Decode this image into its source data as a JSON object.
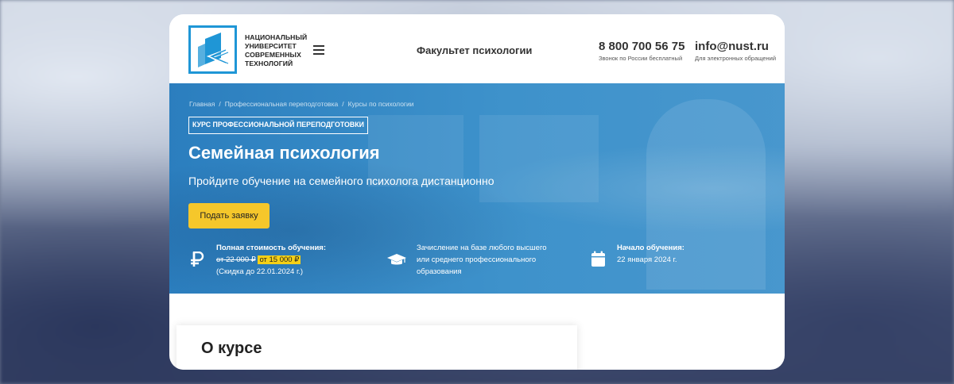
{
  "header": {
    "logo_lines": [
      "НАЦИОНАЛЬНЫЙ",
      "УНИВЕРСИТЕТ",
      "СОВРЕМЕННЫХ",
      "ТЕХНОЛОГИЙ"
    ],
    "faculty": "Факультет психологии",
    "phone": "8 800 700 56 75",
    "phone_note": "Звонок по России бесплатный",
    "email": "info@nust.ru",
    "email_note": "Для электронных обращений"
  },
  "breadcrumbs": [
    "Главная",
    "Профессиональная переподготовка",
    "Курсы по психологии"
  ],
  "hero": {
    "tag": "КУРС ПРОФЕССИОНАЛЬНОЙ ПЕРЕПОДГОТОВКИ",
    "title": "Семейная психология",
    "subtitle": "Пройдите обучение на семейного психолога дистанционно",
    "apply_button": "Подать заявку"
  },
  "features": {
    "price": {
      "label": "Полная стоимость обучения:",
      "old_price": "от 22 000 ₽",
      "new_price": "от 15 000 ₽",
      "discount_note": "(Скидка до 22.01.2024 г.)",
      "icon": "ruble-icon"
    },
    "enrollment": {
      "lines": [
        "Зачисление на базе любого высшего",
        "или среднего профессионального",
        "образования"
      ],
      "icon": "graduation-cap-icon"
    },
    "start": {
      "label": "Начало обучения:",
      "date": "22 января 2024 г.",
      "icon": "calendar-icon"
    }
  },
  "about": {
    "title": "О курсе"
  },
  "colors": {
    "brand_blue": "#1f96d6",
    "hero_blue": "#3e92cb",
    "accent_yellow": "#f5c72b"
  }
}
